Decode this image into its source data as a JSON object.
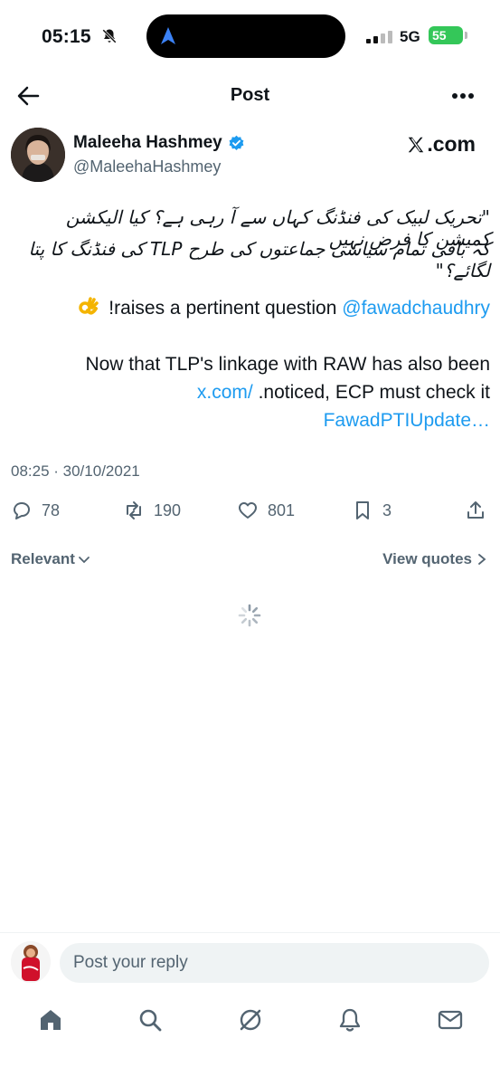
{
  "status_bar": {
    "time": "05:15",
    "network": "5G",
    "battery": "55"
  },
  "header": {
    "title": "Post"
  },
  "author": {
    "name": "Maleeha Hashmey",
    "handle": "@MaleehaHashmey",
    "source": ".com"
  },
  "tweet": {
    "urdu_line1": "\"تحریک لبیک کی فنڈنگ کہاں سے آ رہی ہے؟ کیا الیکشن کمیشن کا فرض نہیں",
    "urdu_line2": "کہ باقی تمام سیاسی جماعتوں کی طرح TLP کی فنڈنگ کا پتا لگائے؟\"",
    "mention": "@fawadchaudhry",
    "mention_text": " !raises a pertinent question",
    "line3": "Now that TLP's linkage with RAW has also been",
    "line4_link": "x.com/",
    "line4_text": " .noticed, ECP must check it",
    "line5_link": "FawadPTIUpdate…",
    "timestamp": "08:25 · 30/10/2021"
  },
  "actions": {
    "replies": "78",
    "reposts": "190",
    "likes": "801",
    "bookmarks": "3"
  },
  "sort": {
    "relevant": "Relevant",
    "view_quotes": "View quotes"
  },
  "reply": {
    "placeholder": "Post your reply"
  },
  "icons": {
    "back": "back-arrow-icon",
    "more": "more-icon",
    "verified": "verified-badge-icon",
    "reply": "reply-icon",
    "repost": "repost-icon",
    "like": "like-icon",
    "bookmark": "bookmark-icon",
    "share": "share-icon",
    "nav": [
      "home-icon",
      "search-icon",
      "grok-icon",
      "notifications-icon",
      "messages-icon"
    ]
  },
  "colors": {
    "link": "#1d9bf0",
    "verified": "#1d9bf0",
    "muted": "#536471",
    "battery": "#34c759"
  }
}
